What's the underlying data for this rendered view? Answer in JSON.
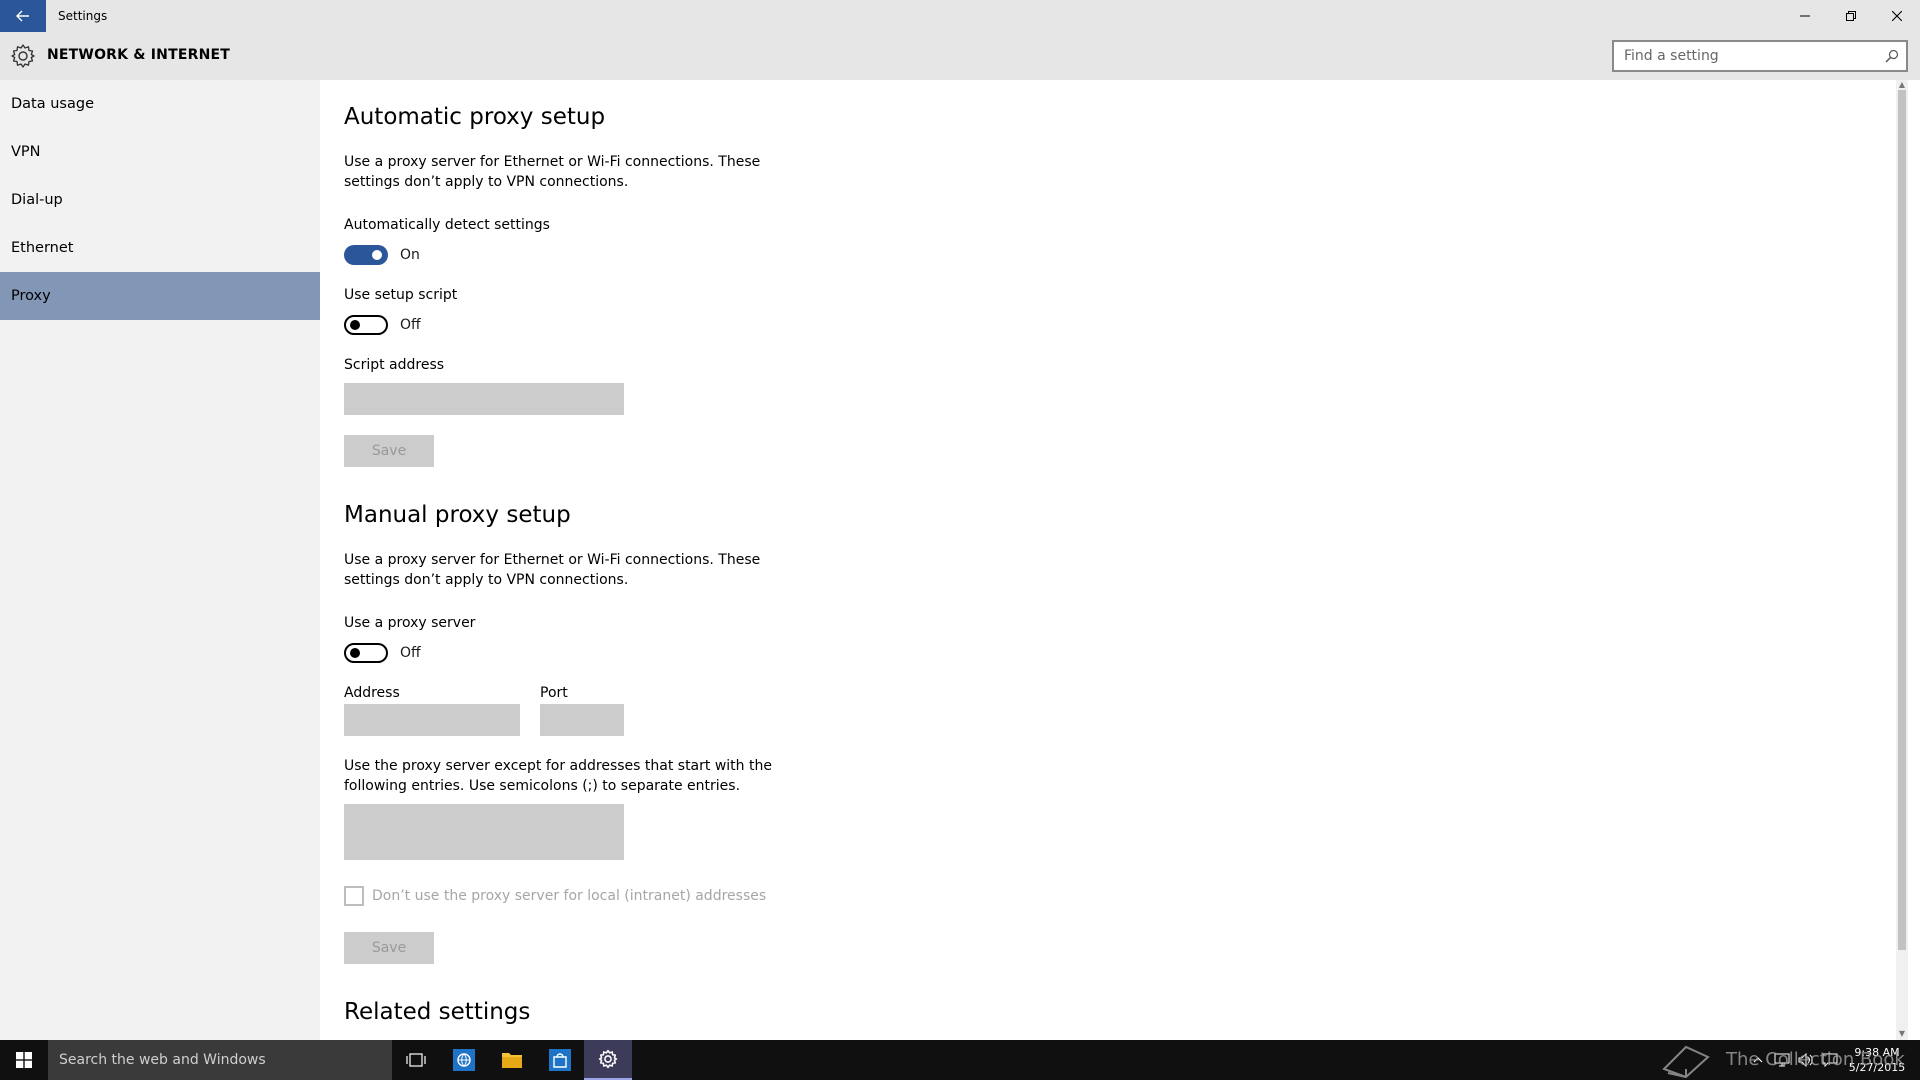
{
  "window": {
    "title": "Settings",
    "minimize_glyph": "─",
    "restore_glyph": "❐",
    "close_glyph": "✕"
  },
  "header": {
    "title": "NETWORK & INTERNET",
    "search_placeholder": "Find a setting"
  },
  "sidebar": {
    "items": [
      {
        "label": "Data usage",
        "active": false
      },
      {
        "label": "VPN",
        "active": false
      },
      {
        "label": "Dial-up",
        "active": false
      },
      {
        "label": "Ethernet",
        "active": false
      },
      {
        "label": "Proxy",
        "active": true
      }
    ]
  },
  "automatic": {
    "heading": "Automatic proxy setup",
    "description": "Use a proxy server for Ethernet or Wi-Fi connections. These settings don’t apply to VPN connections.",
    "detect_label": "Automatically detect settings",
    "detect_state": "On",
    "script_label": "Use setup script",
    "script_state": "Off",
    "address_label": "Script address",
    "save_label": "Save"
  },
  "manual": {
    "heading": "Manual proxy setup",
    "description": "Use a proxy server for Ethernet or Wi-Fi connections. These settings don’t apply to VPN connections.",
    "use_proxy_label": "Use a proxy server",
    "use_proxy_state": "Off",
    "address_label": "Address",
    "port_label": "Port",
    "exceptions_label": "Use the proxy server except for addresses that start with the following entries. Use semicolons (;) to separate entries.",
    "local_checkbox_label": "Don’t use the proxy server for local (intranet) addresses",
    "save_label": "Save"
  },
  "related": {
    "heading": "Related settings"
  },
  "taskbar": {
    "search_text": "Search the web and Windows",
    "watermark": "The Collection Book",
    "time": "9:38 AM",
    "date": "5/27/2015"
  },
  "colors": {
    "accent": "#2b579a",
    "sidebar_active": "#8297b5",
    "chrome": "#e6e6e6",
    "taskbar": "#101010"
  }
}
